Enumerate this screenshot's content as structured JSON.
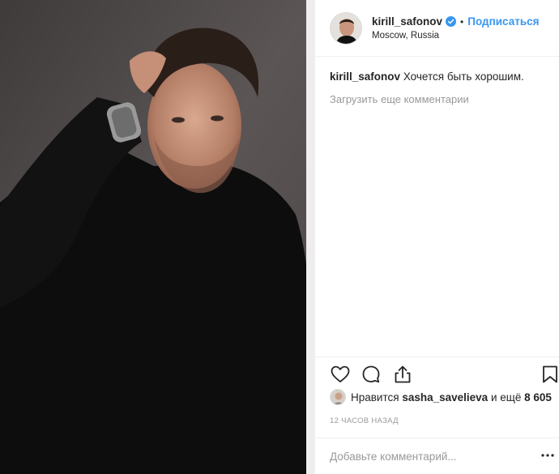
{
  "post": {
    "photo": {
      "description_icon": "portrait-photo"
    },
    "header": {
      "username": "kirill_safonov",
      "verified": true,
      "separator": "•",
      "follow_label": "Подписаться",
      "location": "Moscow, Russia"
    },
    "caption": {
      "username": "kirill_safonov",
      "text": "Хочется быть хорошим."
    },
    "load_more_label": "Загрузить еще комментарии",
    "actions": {
      "icons": [
        "heart-icon",
        "comment-icon",
        "share-icon",
        "bookmark-icon"
      ]
    },
    "likes": {
      "prefix": "Нравится",
      "user": "sasha_savelieva",
      "middle": "и ещё",
      "count": "8 605"
    },
    "timestamp": "12 часов назад",
    "add_comment": {
      "placeholder": "Добавьте комментарий..."
    }
  },
  "colors": {
    "link_blue": "#3897f0",
    "text": "#262626",
    "muted": "#999999",
    "border": "#efefef",
    "verified_badge": "#3897f0"
  }
}
